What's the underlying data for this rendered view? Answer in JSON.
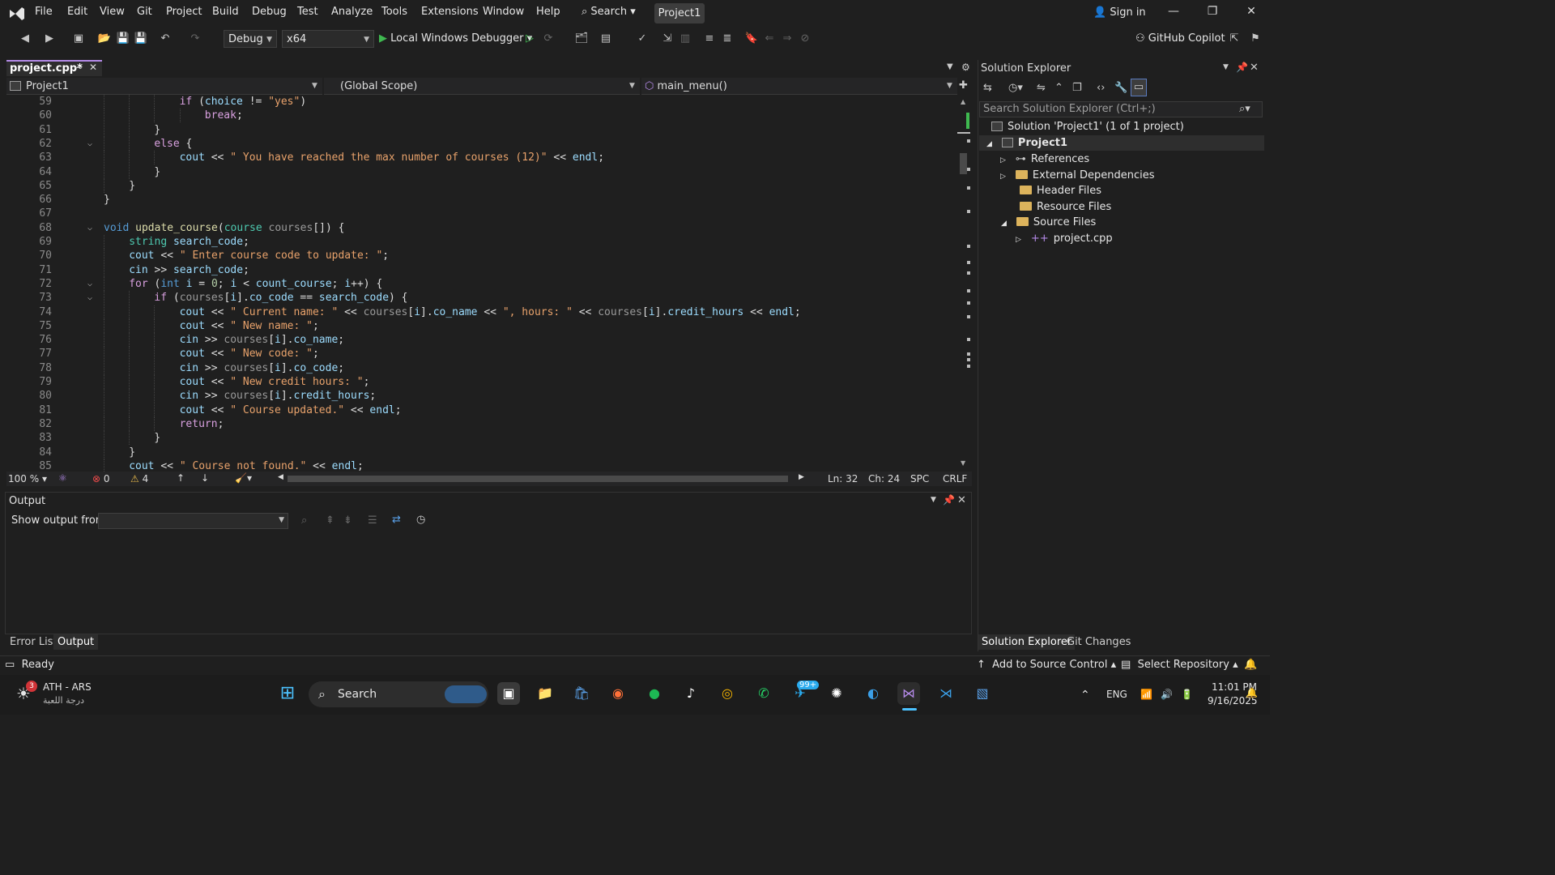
{
  "menu": [
    "File",
    "Edit",
    "View",
    "Git",
    "Project",
    "Build",
    "Debug",
    "Test",
    "Analyze",
    "Tools",
    "Extensions",
    "Window",
    "Help"
  ],
  "search_label": "Search",
  "project_badge": "Project1",
  "sign_in": "Sign in",
  "toolbar": {
    "config": "Debug",
    "platform": "x64",
    "debugger": "Local Windows Debugger",
    "copilot": "GitHub Copilot"
  },
  "editor": {
    "tab": "project.cpp*",
    "nav_project": "Project1",
    "nav_scope": "(Global Scope)",
    "nav_member": "main_menu()",
    "lines": [
      {
        "n": "59",
        "indent": 6,
        "html": "<span class='ctl'>if</span> (<span class='var'>choice</span> != <span class='str'>\"yes\"</span>)"
      },
      {
        "n": "60",
        "indent": 8,
        "html": "<span class='ctl'>break</span>;"
      },
      {
        "n": "61",
        "indent": 4,
        "html": "}"
      },
      {
        "n": "62",
        "indent": 4,
        "fold": true,
        "html": "<span class='ctl'>else</span> {"
      },
      {
        "n": "63",
        "indent": 6,
        "html": "<span class='var'>cout</span> &lt;&lt; <span class='str'>\" You have reached the max number of courses (12)\"</span> &lt;&lt; <span class='var'>endl</span>;"
      },
      {
        "n": "64",
        "indent": 4,
        "html": "}"
      },
      {
        "n": "65",
        "indent": 2,
        "html": "}"
      },
      {
        "n": "66",
        "indent": 0,
        "html": "}"
      },
      {
        "n": "67",
        "indent": 0,
        "html": ""
      },
      {
        "n": "68",
        "indent": 0,
        "fold": true,
        "html": "<span class='kw'>void</span> <span class='fn'>update_course</span>(<span class='ty'>course</span> <span class='par'>courses</span>[]) {"
      },
      {
        "n": "69",
        "indent": 2,
        "html": "<span class='ty'>string</span> <span class='var'>search_code</span>;"
      },
      {
        "n": "70",
        "indent": 2,
        "html": "<span class='var'>cout</span> &lt;&lt; <span class='str'>\" Enter course code to update: \"</span>;"
      },
      {
        "n": "71",
        "indent": 2,
        "html": "<span class='var'>cin</span> &gt;&gt; <span class='var'>search_code</span>;"
      },
      {
        "n": "72",
        "indent": 2,
        "fold": true,
        "html": "<span class='ctl'>for</span> (<span class='kw'>int</span> <span class='var'>i</span> = <span class='num'>0</span>; <span class='var'>i</span> &lt; <span class='var'>count_course</span>; <span class='var'>i</span>++) {"
      },
      {
        "n": "73",
        "indent": 4,
        "fold": true,
        "html": "<span class='ctl'>if</span> (<span class='par'>courses</span>[<span class='var'>i</span>].<span class='var'>co_code</span> == <span class='var'>search_code</span>) {"
      },
      {
        "n": "74",
        "indent": 6,
        "html": "<span class='var'>cout</span> &lt;&lt; <span class='str'>\" Current name: \"</span> &lt;&lt; <span class='par'>courses</span>[<span class='var'>i</span>].<span class='var'>co_name</span> &lt;&lt; <span class='str'>\", hours: \"</span> &lt;&lt; <span class='par'>courses</span>[<span class='var'>i</span>].<span class='var'>credit_hours</span> &lt;&lt; <span class='var'>endl</span>;"
      },
      {
        "n": "75",
        "indent": 6,
        "html": "<span class='var'>cout</span> &lt;&lt; <span class='str'>\" New name: \"</span>;"
      },
      {
        "n": "76",
        "indent": 6,
        "html": "<span class='var'>cin</span> &gt;&gt; <span class='par'>courses</span>[<span class='var'>i</span>].<span class='var'>co_name</span>;"
      },
      {
        "n": "77",
        "indent": 6,
        "html": "<span class='var'>cout</span> &lt;&lt; <span class='str'>\" New code: \"</span>;"
      },
      {
        "n": "78",
        "indent": 6,
        "html": "<span class='var'>cin</span> &gt;&gt; <span class='par'>courses</span>[<span class='var'>i</span>].<span class='var'>co_code</span>;"
      },
      {
        "n": "79",
        "indent": 6,
        "html": "<span class='var'>cout</span> &lt;&lt; <span class='str'>\" New credit hours: \"</span>;"
      },
      {
        "n": "80",
        "indent": 6,
        "html": "<span class='var'>cin</span> &gt;&gt; <span class='par'>courses</span>[<span class='var'>i</span>].<span class='var'>credit_hours</span>;"
      },
      {
        "n": "81",
        "indent": 6,
        "html": "<span class='var'>cout</span> &lt;&lt; <span class='str'>\" Course updated.\"</span> &lt;&lt; <span class='var'>endl</span>;"
      },
      {
        "n": "82",
        "indent": 6,
        "html": "<span class='ctl'>return</span>;"
      },
      {
        "n": "83",
        "indent": 4,
        "html": "}"
      },
      {
        "n": "84",
        "indent": 2,
        "html": "}"
      },
      {
        "n": "85",
        "indent": 2,
        "html": "<span class='var'>cout</span> &lt;&lt; <span class='str'>\" Course not found.\"</span> &lt;&lt; <span class='var'>endl</span>;"
      }
    ],
    "zoom": "100 %",
    "errors": "0",
    "warnings": "4",
    "ln": "Ln: 32",
    "ch": "Ch: 24",
    "spc": "SPC",
    "crlf": "CRLF"
  },
  "output": {
    "title": "Output",
    "show_from": "Show output from:"
  },
  "bottom_tabs": {
    "errors": "Error List",
    "output": "Output"
  },
  "solution_explorer": {
    "title": "Solution Explorer",
    "search_placeholder": "Search Solution Explorer (Ctrl+;)",
    "solution": "Solution 'Project1' (1 of 1 project)",
    "project": "Project1",
    "references": "References",
    "external": "External Dependencies",
    "headers": "Header Files",
    "resources": "Resource Files",
    "sources": "Source Files",
    "file": "project.cpp",
    "tab_se": "Solution Explorer",
    "tab_git": "Git Changes"
  },
  "status": {
    "ready": "Ready",
    "add_source": "Add to Source Control",
    "select_repo": "Select Repository"
  },
  "taskbar": {
    "weather_title": "ATH - ARS",
    "weather_sub": "درجة اللعبة",
    "weather_badge": "3",
    "search": "Search",
    "telegram_badge": "99+",
    "lang": "ENG",
    "time": "11:01 PM",
    "date": "9/16/2025"
  }
}
